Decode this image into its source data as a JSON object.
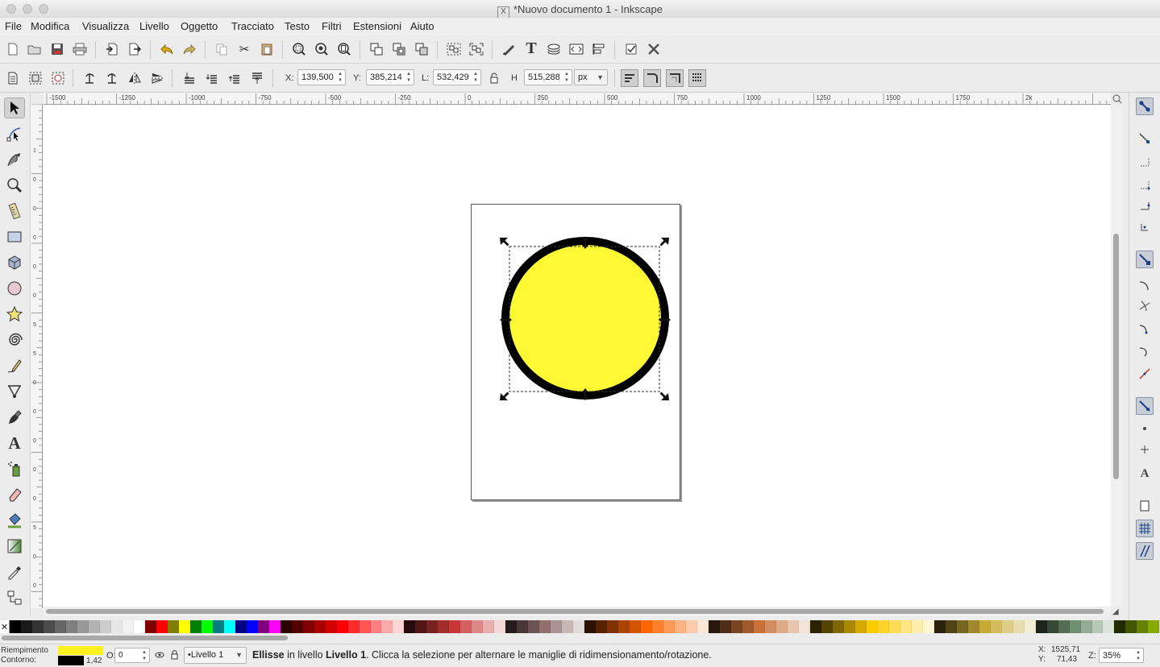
{
  "window": {
    "title": "*Nuovo documento 1 - Inkscape"
  },
  "menu": [
    "File",
    "Modifica",
    "Visualizza",
    "Livello",
    "Oggetto",
    "Tracciato",
    "Testo",
    "Filtri",
    "Estensioni",
    "Aiuto"
  ],
  "toolbar": {
    "commands": [
      "new-document-icon",
      "open-icon",
      "save-icon",
      "print-icon",
      "import-icon",
      "export-icon",
      "undo-icon",
      "redo-icon",
      "copy-icon",
      "cut-icon",
      "paste-icon",
      "zoom-selection-icon",
      "zoom-drawing-icon",
      "zoom-page-icon",
      "duplicate-icon",
      "clone-icon",
      "unlink-clone-icon",
      "group-icon",
      "ungroup-icon",
      "fill-stroke-icon",
      "text-font-icon",
      "layers-icon",
      "xml-editor-icon",
      "align-icon",
      "preferences-icon",
      "document-properties-icon"
    ]
  },
  "selector_toolbar": {
    "x_label": "X:",
    "x_value": "139,500",
    "y_label": "Y:",
    "y_value": "385,214",
    "w_label": "L:",
    "w_value": "532,429",
    "h_label": "H",
    "h_value": "515,288",
    "unit": "px"
  },
  "ruler": {
    "h_labels": [
      "-1500",
      "-1250",
      "-1000",
      "-750",
      "-500",
      "-250",
      "0",
      "250",
      "500",
      "750",
      "1000",
      "1250",
      "1500",
      "1750",
      "2k"
    ],
    "v_labels": [
      "1",
      "0",
      "0",
      "0",
      "0",
      "0",
      "5",
      "5",
      "0",
      "0",
      "0",
      "0",
      "0",
      "5",
      "0",
      "0"
    ]
  },
  "canvas": {
    "ellipse_fill": "#fff834",
    "ellipse_stroke": "#000000"
  },
  "palette": [
    "#000000",
    "#1a1a1a",
    "#333333",
    "#4d4d4d",
    "#666666",
    "#808080",
    "#999999",
    "#b3b3b3",
    "#cccccc",
    "#e6e6e6",
    "#f2f2f2",
    "#ffffff",
    "#800000",
    "#ff0000",
    "#808000",
    "#ffff00",
    "#008000",
    "#00ff00",
    "#008080",
    "#00ffff",
    "#000080",
    "#0000ff",
    "#800080",
    "#ff00ff",
    "#2b0000",
    "#550000",
    "#800000",
    "#aa0000",
    "#d40000",
    "#ff0000",
    "#ff2a2a",
    "#ff5555",
    "#ff8080",
    "#ffaaaa",
    "#ffd5d5",
    "#280b0b",
    "#501616",
    "#782121",
    "#a02c2c",
    "#c83737",
    "#d35f5f",
    "#de8787",
    "#e9afaf",
    "#f4d7d7",
    "#241c1c",
    "#483737",
    "#6c5353",
    "#916f6f",
    "#ac9393",
    "#c8b7b7",
    "#e3dbdb",
    "#2b1100",
    "#552200",
    "#803300",
    "#aa4400",
    "#d45500",
    "#ff6600",
    "#ff7f2a",
    "#ff9955",
    "#ffb380",
    "#ffccaa",
    "#ffe6d5",
    "#28170b",
    "#502d16",
    "#784421",
    "#a05a2c",
    "#c87137",
    "#d38d5f",
    "#deaa87",
    "#e9c6af",
    "#f4e3d7",
    "#2b2200",
    "#554400",
    "#806600",
    "#aa8800",
    "#d4aa00",
    "#ffcc00",
    "#ffd42a",
    "#ffdd55",
    "#ffe680",
    "#ffeeaa",
    "#fff6d5",
    "#28220b",
    "#504416",
    "#786721",
    "#a0892c",
    "#c8ab37",
    "#d3bc5f",
    "#decd87",
    "#e9ddaf",
    "#f4eed7",
    "#1c241c",
    "#374837",
    "#536c53",
    "#6f916f",
    "#93ac93",
    "#b7c8b7",
    "#dbe3db",
    "#222b00",
    "#445500",
    "#668000",
    "#88aa00"
  ],
  "status": {
    "fill_label": "Riempimento",
    "stroke_label": "Contorno:",
    "fill_color": "#fff11f",
    "stroke_color": "#000000",
    "stroke_width": "1,42",
    "opacity_label": "O:",
    "opacity_value": "0",
    "layer": "•Livello 1",
    "object_name": "Ellisse",
    "message_pre": " in livello ",
    "message_layer": "Livello 1",
    "message_post": ". Clicca la selezione per alternare le maniglie di ridimensionamento/rotazione.",
    "cursor_x_label": "X:",
    "cursor_x": "1525,71",
    "cursor_y_label": "Y:",
    "cursor_y": "71,43",
    "zoom_label": "Z:",
    "zoom_value": "35%"
  }
}
